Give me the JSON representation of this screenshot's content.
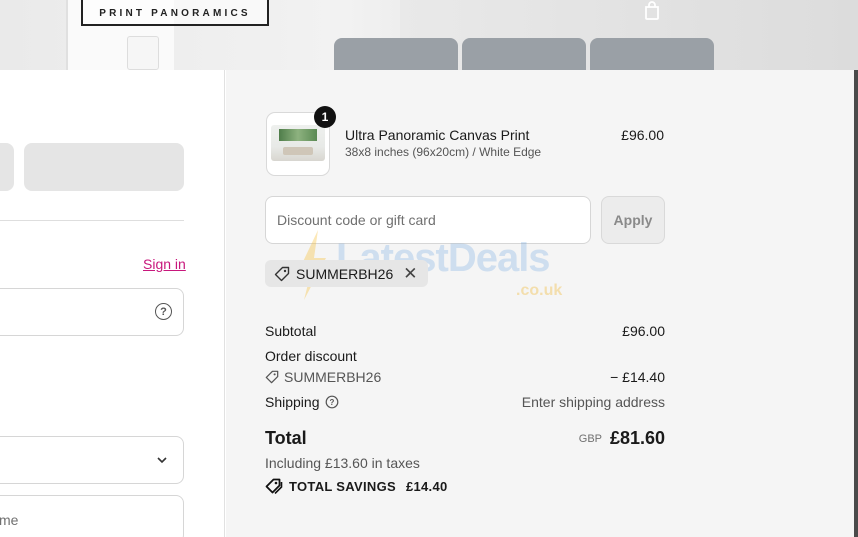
{
  "header": {
    "brand": "PRINT PANORAMICS",
    "cart_icon": "shopping-bag-icon"
  },
  "left": {
    "sign_in_label": "Sign in",
    "partial_field_text": "me"
  },
  "order": {
    "item": {
      "quantity": "1",
      "name": "Ultra Panoramic Canvas Print",
      "variant": "38x8 inches (96x20cm) / White Edge",
      "price": "£96.00"
    },
    "discount": {
      "placeholder": "Discount code or gift card",
      "apply_label": "Apply",
      "applied_code": "SUMMERBH26"
    },
    "summary": {
      "subtotal_label": "Subtotal",
      "subtotal_value": "£96.00",
      "discount_label": "Order discount",
      "discount_code": "SUMMERBH26",
      "discount_value": "− £14.40",
      "shipping_label": "Shipping",
      "shipping_value": "Enter shipping address",
      "total_label": "Total",
      "currency": "GBP",
      "total_value": "£81.60",
      "taxes_note": "Including £13.60 in taxes",
      "savings_label": "TOTAL SAVINGS",
      "savings_value": "£14.40"
    }
  },
  "watermark": {
    "text": "LatestDeals",
    "sub": ".co.uk"
  },
  "colors": {
    "accent_link": "#c8177c",
    "summary_bg": "#f5f5f5"
  }
}
